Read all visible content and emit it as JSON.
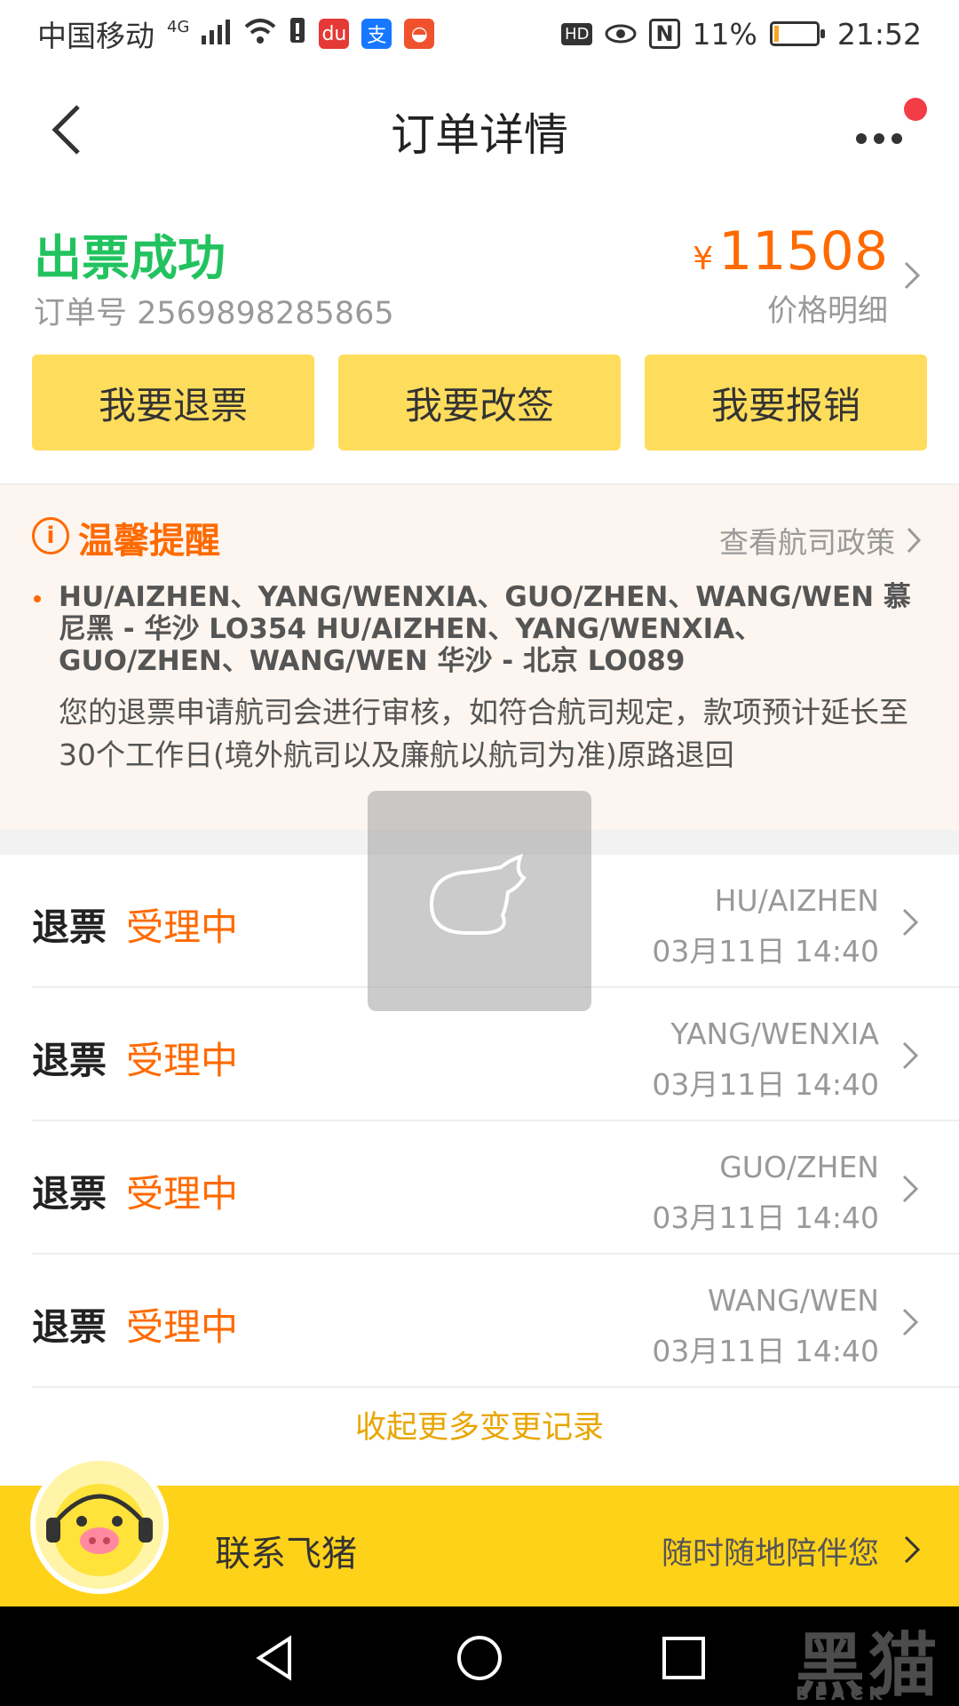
{
  "status_bar": {
    "carrier": "中国移动",
    "network": "4G",
    "battery_percent": "11%",
    "time": "21:52",
    "hd_badge": "HD",
    "nfc_letter": "N"
  },
  "nav": {
    "title": "订单详情"
  },
  "order": {
    "status": "出票成功",
    "order_no": "订单号 2569898285865",
    "currency": "¥",
    "price": "11508",
    "price_detail": "价格明细"
  },
  "actions": {
    "refund": "我要退票",
    "change": "我要改签",
    "reimburse": "我要报销"
  },
  "reminder": {
    "title": "温馨提醒",
    "policy_link": "查看航司政策",
    "flights": "HU/AIZHEN、YANG/WENXIA、GUO/ZHEN、WANG/WEN 慕尼黑 - 华沙 LO354 HU/AIZHEN、YANG/WENXIA、GUO/ZHEN、WANG/WEN 华沙 - 北京 LO089",
    "note": "您的退票申请航司会进行审核，如符合航司规定，款项预计延长至30个工作日(境外航司以及廉航以航司为准)原路退回"
  },
  "refunds": [
    {
      "label": "退票",
      "status": "受理中",
      "name": "HU/AIZHEN",
      "time": "03月11日 14:40"
    },
    {
      "label": "退票",
      "status": "受理中",
      "name": "YANG/WENXIA",
      "time": "03月11日 14:40"
    },
    {
      "label": "退票",
      "status": "受理中",
      "name": "GUO/ZHEN",
      "time": "03月11日 14:40"
    },
    {
      "label": "退票",
      "status": "受理中",
      "name": "WANG/WEN",
      "time": "03月11日 14:40"
    }
  ],
  "collapse_link": "收起更多变更记录",
  "contact": {
    "label": "联系飞猪",
    "subtitle": "随时随地陪伴您"
  },
  "watermark": {
    "text": "黑猫",
    "sub": "BLACK CAT"
  },
  "colors": {
    "success_green": "#22c35f",
    "accent_orange": "#ff6a00",
    "button_yellow": "#ffdd5c",
    "contact_yellow": "#ffd21a",
    "reminder_bg": "#fdf5ef"
  },
  "icons": [
    "back-icon",
    "more-icon",
    "chevron-right-icon",
    "info-icon",
    "loading-icon",
    "mascot-icon",
    "nav-back-icon",
    "nav-home-icon",
    "nav-recent-icon"
  ]
}
